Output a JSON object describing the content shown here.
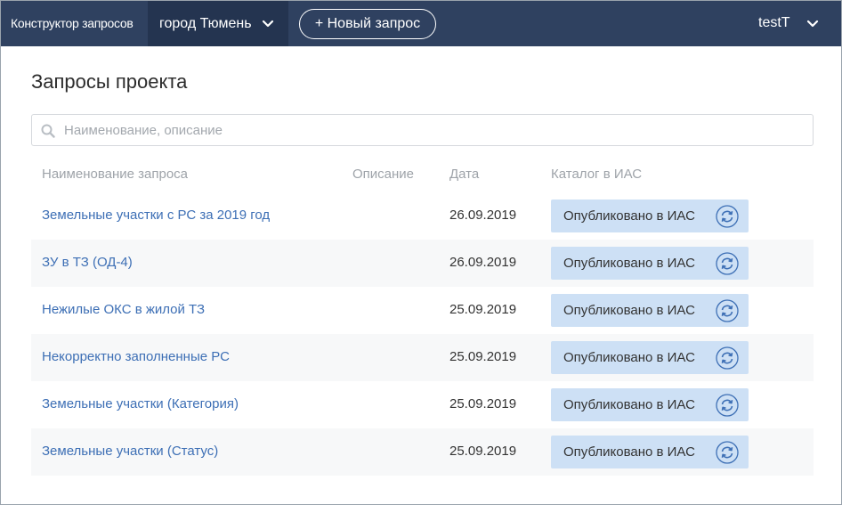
{
  "header": {
    "app_title": "Конструктор запросов",
    "city": "город Тюмень",
    "new_request_label": "+ Новый запрос",
    "user": "testT"
  },
  "page": {
    "title": "Запросы проекта"
  },
  "search": {
    "placeholder": "Наименование, описание",
    "value": ""
  },
  "table": {
    "columns": [
      "Наименование запроса",
      "Описание",
      "Дата",
      "Каталог в ИАС"
    ],
    "rows": [
      {
        "name": "Земельные участки с РС за 2019 год",
        "description": "",
        "date": "26.09.2019",
        "status": "Опубликовано в ИАС"
      },
      {
        "name": "ЗУ в ТЗ (ОД-4)",
        "description": "",
        "date": "26.09.2019",
        "status": "Опубликовано в ИАС"
      },
      {
        "name": "Нежилые ОКС в жилой ТЗ",
        "description": "",
        "date": "25.09.2019",
        "status": "Опубликовано в ИАС"
      },
      {
        "name": "Некорректно заполненные РС",
        "description": "",
        "date": "25.09.2019",
        "status": "Опубликовано в ИАС"
      },
      {
        "name": "Земельные участки (Категория)",
        "description": "",
        "date": "25.09.2019",
        "status": "Опубликовано в ИАС"
      },
      {
        "name": "Земельные участки (Статус)",
        "description": "",
        "date": "25.09.2019",
        "status": "Опубликовано в ИАС"
      }
    ]
  },
  "colors": {
    "topbar": "#2f4160",
    "city_bg": "#243450",
    "link": "#3d6fb5",
    "status_bg": "#cde0f5",
    "icon": "#3d6fb5"
  },
  "icons": {
    "city_dropdown": "chevron-down-icon",
    "user_dropdown": "chevron-down-icon",
    "search": "search-icon",
    "republish": "refresh-icon"
  }
}
